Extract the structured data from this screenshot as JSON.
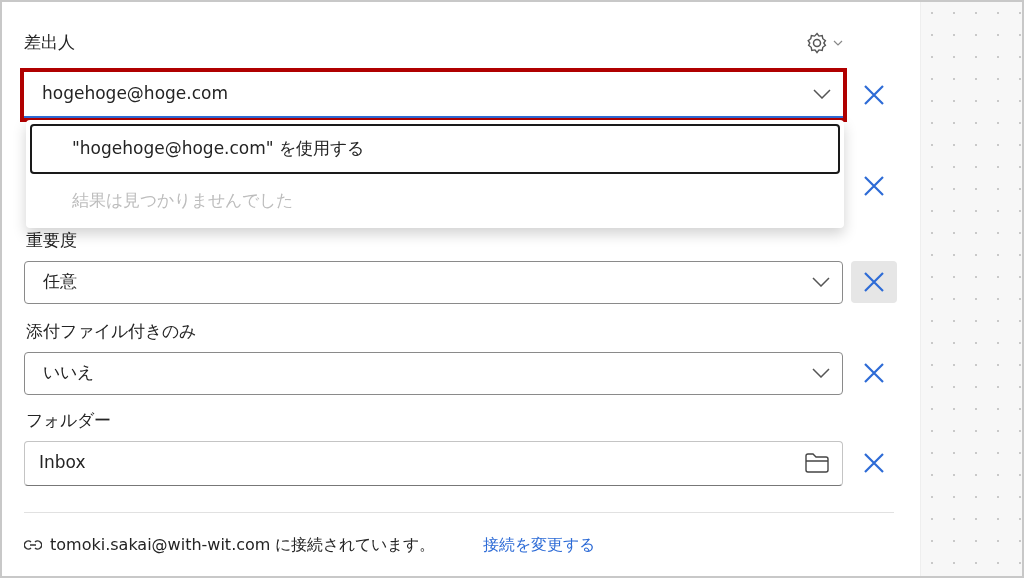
{
  "header": {
    "label": "差出人"
  },
  "sender": {
    "value": "hogehoge@hoge.com",
    "annotated": true,
    "focused": true,
    "expanded": true,
    "menu": [
      {
        "kind": "option",
        "text": "\"hogehoge@hoge.com\" を使用する",
        "selected": true
      },
      {
        "kind": "empty",
        "text": "結果は見つかりませんでした"
      }
    ]
  },
  "covered_row": {
    "clear_visible": true
  },
  "fields": [
    {
      "label": "重要度",
      "kind": "select",
      "value": "任意",
      "clear_hovered": true
    },
    {
      "label": "添付ファイル付きのみ",
      "kind": "select",
      "value": "いいえ",
      "clear_hovered": false
    },
    {
      "label": "フォルダー",
      "kind": "folder",
      "value": "Inbox",
      "clear_hovered": false
    }
  ],
  "footer": {
    "text": "tomoki.sakai@with-wit.com に接続されています。",
    "link": "接続を変更する"
  }
}
